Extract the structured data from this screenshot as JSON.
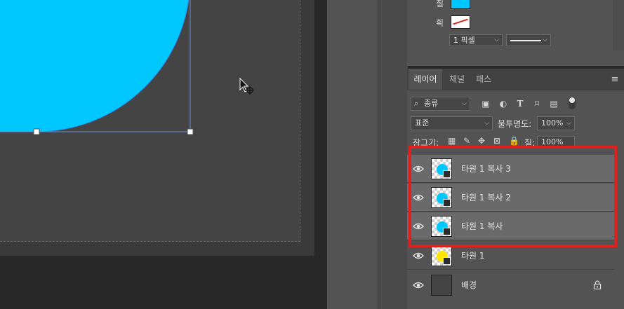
{
  "colors": {
    "ellipse_fill": "#00c8ff",
    "ellipse_stroke": "#3c7fe0",
    "yellow_layer": "#ffe600",
    "highlight": "#e01f1f"
  },
  "properties": {
    "fill_label": "칠",
    "stroke_label": "획",
    "stroke_width": "1 픽셀"
  },
  "layers_panel": {
    "tabs": [
      {
        "label": "레이어",
        "active": true
      },
      {
        "label": "채널",
        "active": false
      },
      {
        "label": "패스",
        "active": false
      }
    ],
    "filter_kind": "종류",
    "blend_mode": "표준",
    "opacity_label": "불투명도:",
    "opacity_value": "100%",
    "lock_label": "잠그기:",
    "fill_label": "칠:",
    "fill_value": "100%",
    "layers": [
      {
        "name": "타원 1 복사 3",
        "selected": true,
        "thumb": "cyan-ellipse",
        "shape_layer": true
      },
      {
        "name": "타원 1 복사 2",
        "selected": true,
        "thumb": "cyan-ellipse",
        "shape_layer": true
      },
      {
        "name": "타원 1 복사",
        "selected": true,
        "thumb": "cyan-ellipse",
        "shape_layer": true
      },
      {
        "name": "타원 1",
        "selected": false,
        "thumb": "yellow-ellipse",
        "shape_layer": true
      },
      {
        "name": "배경",
        "selected": false,
        "thumb": "background",
        "locked": true
      }
    ]
  },
  "canvas": {
    "cursor": "move-cursor"
  }
}
